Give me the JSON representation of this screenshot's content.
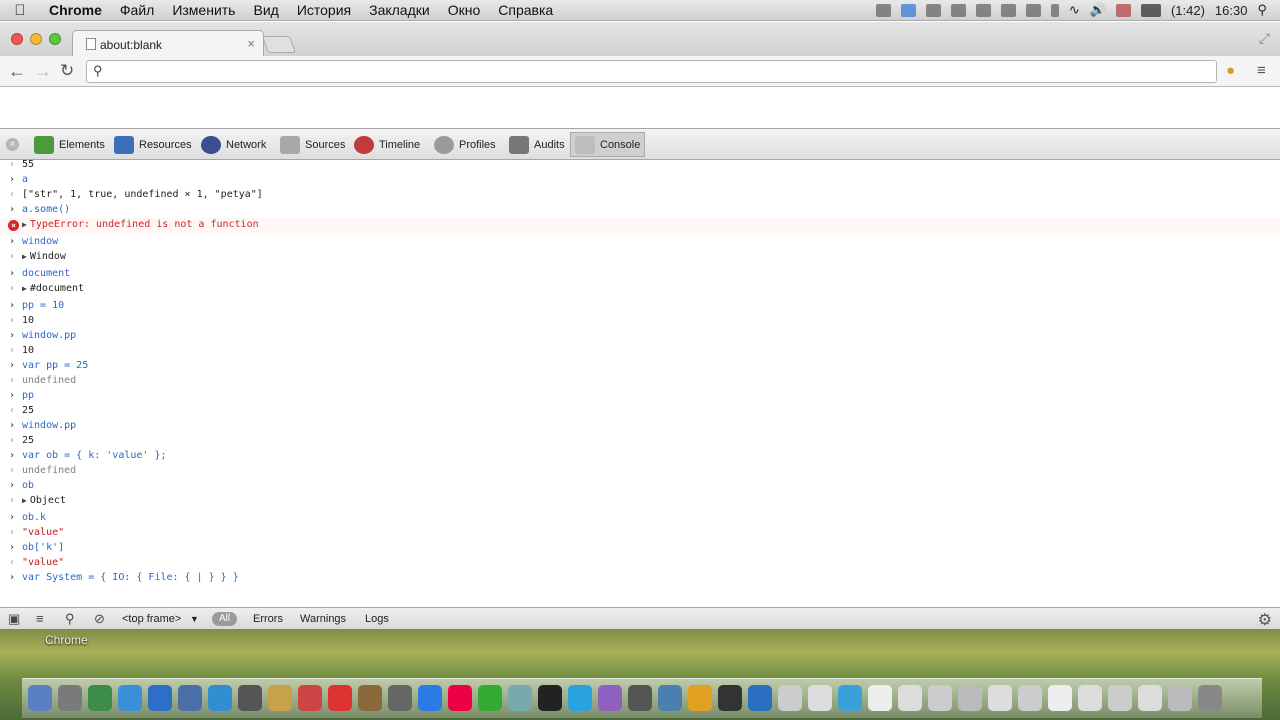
{
  "menubar": {
    "apple_icon": "apple-icon",
    "app": "Chrome",
    "menus": [
      "Файл",
      "Изменить",
      "Вид",
      "История",
      "Закладки",
      "Окно",
      "Справка"
    ],
    "battery": "(1:42)",
    "clock": "16:30"
  },
  "browser": {
    "tab_title": "about:blank",
    "tab_close": "×",
    "omnibox_value": "",
    "omnibox_placeholder": ""
  },
  "devtools": {
    "tabs": [
      {
        "label": "Elements",
        "icon": "elements-icon",
        "color": "#4c9a3c"
      },
      {
        "label": "Resources",
        "icon": "resources-icon",
        "color": "#3d6fb8"
      },
      {
        "label": "Network",
        "icon": "network-icon",
        "color": "#3b4f8f"
      },
      {
        "label": "Sources",
        "icon": "sources-icon",
        "color": "#a9a9a9"
      },
      {
        "label": "Timeline",
        "icon": "timeline-icon",
        "color": "#c23b3b"
      },
      {
        "label": "Profiles",
        "icon": "profiles-icon",
        "color": "#9a9a9a"
      },
      {
        "label": "Audits",
        "icon": "audits-icon",
        "color": "#777777"
      },
      {
        "label": "Console",
        "icon": "console-icon",
        "color": "#bdbdbd"
      }
    ],
    "selected_tab": "Console",
    "console": [
      {
        "kind": "out",
        "text": "55"
      },
      {
        "kind": "in",
        "text": "a"
      },
      {
        "kind": "out",
        "text": "[\"str\", 1, true, undefined × 1, \"petya\"]"
      },
      {
        "kind": "in",
        "text": "a.some()"
      },
      {
        "kind": "err",
        "text": "TypeError: undefined is not a function",
        "expand": true
      },
      {
        "kind": "in",
        "text": "window"
      },
      {
        "kind": "out",
        "text": "Window",
        "expand": true
      },
      {
        "kind": "in",
        "text": "document"
      },
      {
        "kind": "out",
        "text": "#document",
        "expand": true
      },
      {
        "kind": "in",
        "text": "pp = 10"
      },
      {
        "kind": "out",
        "text": "10"
      },
      {
        "kind": "in",
        "text": "window.pp"
      },
      {
        "kind": "out",
        "text": "10"
      },
      {
        "kind": "in",
        "text": "var pp = 25"
      },
      {
        "kind": "undef",
        "text": "undefined"
      },
      {
        "kind": "in",
        "text": "pp"
      },
      {
        "kind": "out",
        "text": "25"
      },
      {
        "kind": "in",
        "text": "window.pp"
      },
      {
        "kind": "out",
        "text": "25"
      },
      {
        "kind": "in",
        "text": "var ob = { k: 'value' };"
      },
      {
        "kind": "undef",
        "text": "undefined"
      },
      {
        "kind": "in",
        "text": "ob"
      },
      {
        "kind": "out",
        "text": "Object",
        "expand": true
      },
      {
        "kind": "in",
        "text": "ob.k"
      },
      {
        "kind": "str",
        "text": "\"value\""
      },
      {
        "kind": "in",
        "text": "ob['k']"
      },
      {
        "kind": "str",
        "text": "\"value\""
      },
      {
        "kind": "prompt",
        "text": "var System = { IO: { File: { | } } }"
      }
    ],
    "status": {
      "frame": "<top frame>",
      "all": "All",
      "errors": "Errors",
      "warnings": "Warnings",
      "logs": "Logs"
    }
  },
  "desktop": {
    "hover_label": "Chrome"
  }
}
